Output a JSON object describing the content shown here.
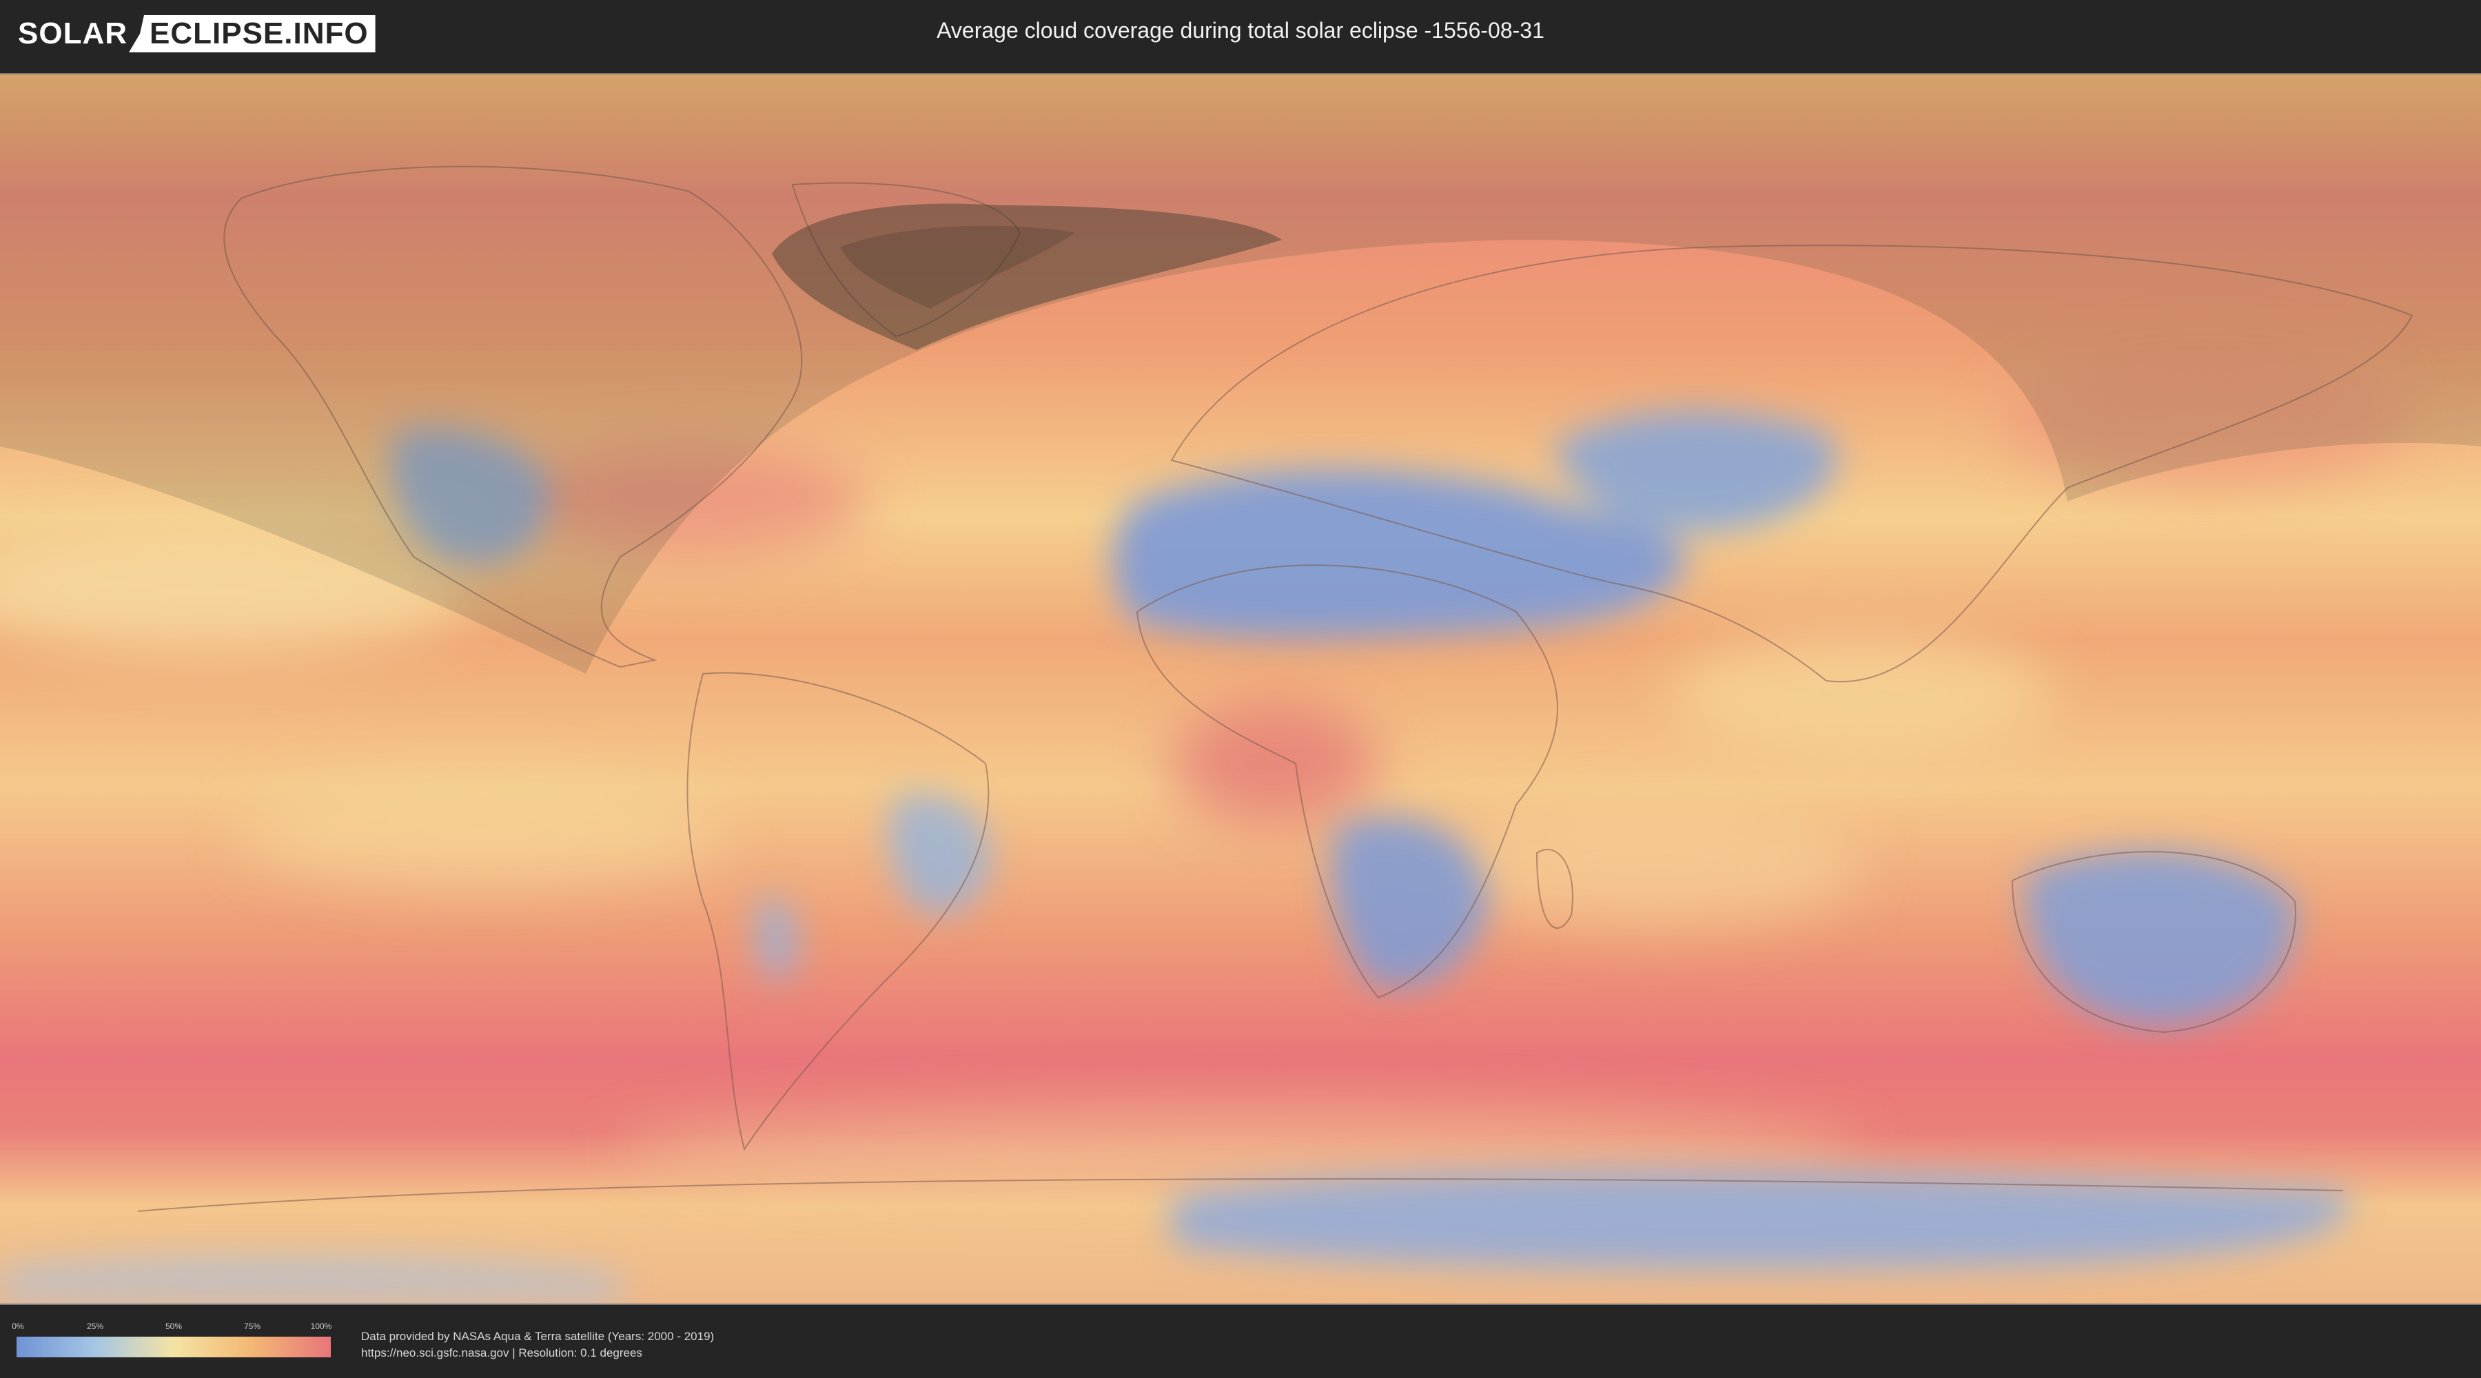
{
  "header": {
    "logo_left": "SOLAR",
    "logo_right": "ECLIPSE.INFO",
    "title": "Average cloud coverage during total solar eclipse -1556-08-31"
  },
  "map": {
    "kind": "cloud-coverage-world-map",
    "overlay": "eclipse-visibility-shading"
  },
  "legend": {
    "ticks": [
      "0%",
      "25%",
      "50%",
      "75%",
      "100%"
    ],
    "colors": [
      "#6f93d6",
      "#a5c6e3",
      "#f4e3a3",
      "#f3b774",
      "#e8767a"
    ]
  },
  "footer": {
    "credit_line1": "Data provided by NASAs Aqua & Terra satellite (Years: 2000 - 2019)",
    "credit_line2": "https://neo.sci.gsfc.nasa.gov | Resolution: 0.1 degrees"
  }
}
